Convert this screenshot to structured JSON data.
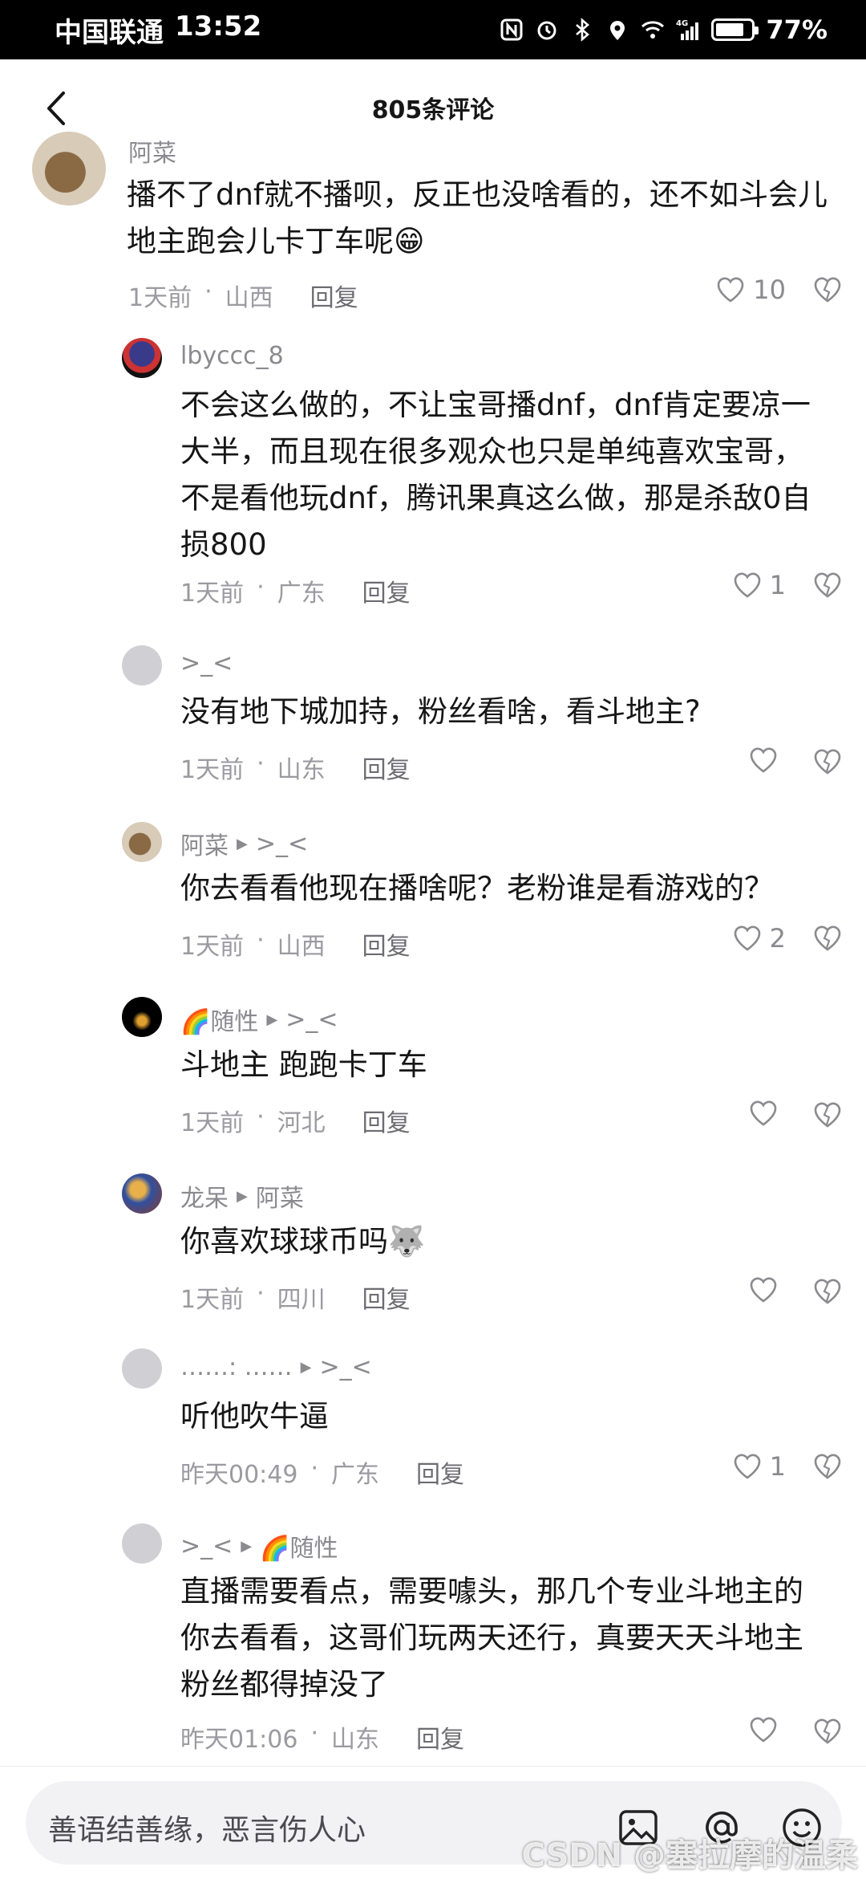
{
  "status": {
    "carrier": "中国联通",
    "time": "13:52",
    "battery": "77%",
    "network": "4G"
  },
  "header": {
    "title": "805条评论"
  },
  "comments": [
    {
      "user": "阿菜",
      "reply_to": "",
      "text": "播不了dnf就不播呗，反正也没啥看的，还不如斗会儿地主跑会儿卡丁车呢😁",
      "time": "1天前",
      "location": "山西",
      "reply": "回复",
      "likes": "10"
    },
    {
      "user": "lbyccc_8",
      "reply_to": "",
      "text": "不会这么做的，不让宝哥播dnf，dnf肯定要凉一大半，而且现在很多观众也只是单纯喜欢宝哥，不是看他玩dnf，腾讯果真这么做，那是杀敌0自损800",
      "time": "1天前",
      "location": "广东",
      "reply": "回复",
      "likes": "1"
    },
    {
      "user": ">_<",
      "reply_to": "",
      "text": "没有地下城加持，粉丝看啥，看斗地主?",
      "time": "1天前",
      "location": "山东",
      "reply": "回复",
      "likes": ""
    },
    {
      "user": "阿菜",
      "reply_to": ">_<",
      "text": "你去看看他现在播啥呢？老粉谁是看游戏的？",
      "time": "1天前",
      "location": "山西",
      "reply": "回复",
      "likes": "2"
    },
    {
      "user": "🌈随性",
      "reply_to": ">_<",
      "text": "斗地主 跑跑卡丁车",
      "time": "1天前",
      "location": "河北",
      "reply": "回复",
      "likes": ""
    },
    {
      "user": "龙呆",
      "reply_to": "阿菜",
      "text": "你喜欢球球币吗🐺",
      "time": "1天前",
      "location": "四川",
      "reply": "回复",
      "likes": ""
    },
    {
      "user": "……:  ……",
      "reply_to": ">_<",
      "text": "听他吹牛逼",
      "time": "昨天00:49",
      "location": "广东",
      "reply": "回复",
      "likes": "1"
    },
    {
      "user": ">_<",
      "reply_to": "🌈随性",
      "text": "直播需要看点，需要噱头，那几个专业斗地主的你去看看，这哥们玩两天还行，真要天天斗地主粉丝都得掉没了",
      "time": "昨天01:06",
      "location": "山东",
      "reply": "回复",
      "likes": ""
    }
  ],
  "input": {
    "placeholder": "善语结善缘，恶言伤人心"
  },
  "watermark": "CSDN @塞拉摩的温柔",
  "colors": {
    "accent": "#161616",
    "meta": "#9a9aa0",
    "username": "#8a8a8f"
  }
}
